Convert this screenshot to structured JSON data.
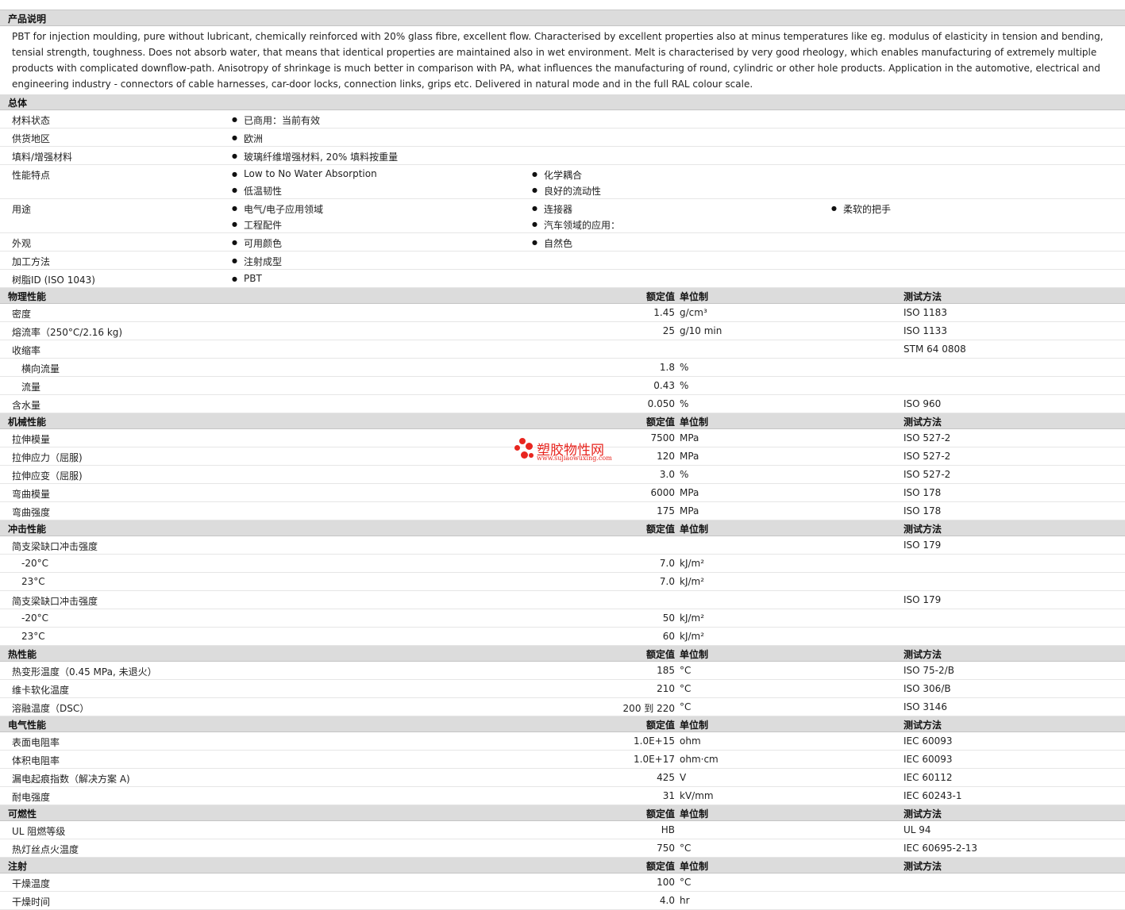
{
  "desc_header": "产品说明",
  "description": "PBT for injection moulding, pure without lubricant, chemically reinforced with 20% glass fibre, excellent flow. Characterised by excellent properties also at minus temperatures like eg. modulus of elasticity in tension and bending, tensial strength, toughness. Does not absorb water, that means that identical properties are maintained also in wet environment. Melt is characterised by very good rheology, which enables manufacturing of extremely multiple products with complicated downflow-path. Anisotropy of shrinkage is much better in comparison with PA, what influences the manufacturing of round, cylindric or other hole products. Application in the automotive, electrical and engineering industry - connectors of cable harnesses, car-door locks, connection links, grips etc. Delivered in natural mode and in the full RAL colour scale.",
  "general": {
    "title": "总体",
    "rows": [
      {
        "name": "材料状态",
        "height": 23,
        "items": [
          {
            "text": "已商用：当前有效",
            "col": 0,
            "line": 0
          }
        ]
      },
      {
        "name": "供货地区",
        "height": 23,
        "items": [
          {
            "text": "欧洲",
            "col": 0,
            "line": 0
          }
        ]
      },
      {
        "name": "填料/增强材料",
        "height": 23,
        "items": [
          {
            "text": "玻璃纤维增强材料, 20% 填料按重量",
            "col": 0,
            "line": 0
          }
        ]
      },
      {
        "name": "性能特点",
        "height": 43,
        "items": [
          {
            "text": "Low to No Water Absorption",
            "col": 0,
            "line": 0
          },
          {
            "text": "化学耦合",
            "col": 1,
            "line": 0
          },
          {
            "text": "低温韧性",
            "col": 0,
            "line": 1
          },
          {
            "text": "良好的流动性",
            "col": 1,
            "line": 1
          }
        ]
      },
      {
        "name": "用途",
        "height": 43,
        "items": [
          {
            "text": "电气/电子应用领域",
            "col": 0,
            "line": 0
          },
          {
            "text": "连接器",
            "col": 1,
            "line": 0
          },
          {
            "text": "柔软的把手",
            "col": 2,
            "line": 0
          },
          {
            "text": "工程配件",
            "col": 0,
            "line": 1
          },
          {
            "text": "汽车领域的应用：",
            "col": 1,
            "line": 1
          }
        ]
      },
      {
        "name": "外观",
        "height": 23,
        "items": [
          {
            "text": "可用颜色",
            "col": 0,
            "line": 0
          },
          {
            "text": "自然色",
            "col": 1,
            "line": 0
          }
        ]
      },
      {
        "name": "加工方法",
        "height": 23,
        "items": [
          {
            "text": "注射成型",
            "col": 0,
            "line": 0
          }
        ]
      },
      {
        "name": "树脂ID (ISO 1043)",
        "height": 23,
        "items": [
          {
            "text": "PBT",
            "col": 0,
            "line": 0
          }
        ]
      }
    ]
  },
  "col_labels": {
    "value": "额定值",
    "unit": "单位制",
    "test": "测试方法"
  },
  "sections": [
    {
      "title": "物理性能",
      "rows": [
        {
          "name": "密度",
          "value": "1.45",
          "unit": "g/cm³",
          "method": "ISO 1183"
        },
        {
          "name": "熔流率（250°C/2.16 kg)",
          "value": "25",
          "unit": "g/10 min",
          "method": "ISO 1133"
        },
        {
          "name": "收缩率",
          "value": "",
          "unit": "",
          "method": "STM 64 0808"
        },
        {
          "name": "横向流量",
          "value": "1.8",
          "unit": "%",
          "method": "",
          "sub": true
        },
        {
          "name": "流量",
          "value": "0.43",
          "unit": "%",
          "method": "",
          "sub": true
        },
        {
          "name": "含水量",
          "value": "0.050",
          "unit": "%",
          "method": "ISO 960"
        }
      ]
    },
    {
      "title": "机械性能",
      "rows": [
        {
          "name": "拉伸模量",
          "value": "7500",
          "unit": "MPa",
          "method": "ISO 527-2"
        },
        {
          "name": "拉伸应力（屈服)",
          "value": "120",
          "unit": "MPa",
          "method": "ISO 527-2"
        },
        {
          "name": "拉伸应变（屈服)",
          "value": "3.0",
          "unit": "%",
          "method": "ISO 527-2"
        },
        {
          "name": "弯曲模量",
          "value": "6000",
          "unit": "MPa",
          "method": "ISO 178"
        },
        {
          "name": "弯曲强度",
          "value": "175",
          "unit": "MPa",
          "method": "ISO 178"
        }
      ]
    },
    {
      "title": "冲击性能",
      "rows": [
        {
          "name": "简支梁缺口冲击强度",
          "value": "",
          "unit": "",
          "method": "ISO 179"
        },
        {
          "name": "-20°C",
          "value": "7.0",
          "unit": "kJ/m²",
          "method": "",
          "sub": true
        },
        {
          "name": "23°C",
          "value": "7.0",
          "unit": "kJ/m²",
          "method": "",
          "sub": true
        },
        {
          "name": "简支梁缺口冲击强度",
          "value": "",
          "unit": "",
          "method": "ISO 179"
        },
        {
          "name": "-20°C",
          "value": "50",
          "unit": "kJ/m²",
          "method": "",
          "sub": true
        },
        {
          "name": "23°C",
          "value": "60",
          "unit": "kJ/m²",
          "method": "",
          "sub": true
        }
      ]
    },
    {
      "title": "热性能",
      "rows": [
        {
          "name": "热变形温度（0.45 MPa, 未退火）",
          "value": "185",
          "unit": "°C",
          "method": "ISO 75-2/B"
        },
        {
          "name": "维卡软化温度",
          "value": "210",
          "unit": "°C",
          "method": "ISO 306/B"
        },
        {
          "name": "溶融温度（DSC）",
          "value": "200 到  220",
          "unit": "°C",
          "method": "ISO 3146"
        }
      ]
    },
    {
      "title": "电气性能",
      "rows": [
        {
          "name": "表面电阻率",
          "value": "1.0E+15",
          "unit": "ohm",
          "method": "IEC 60093"
        },
        {
          "name": "体积电阻率",
          "value": "1.0E+17",
          "unit": "ohm·cm",
          "method": "IEC 60093"
        },
        {
          "name": "漏电起痕指数（解决方案  A)",
          "value": "425",
          "unit": "V",
          "method": "IEC 60112"
        },
        {
          "name": "耐电强度",
          "value": "31",
          "unit": "kV/mm",
          "method": "IEC 60243-1"
        }
      ]
    },
    {
      "title": "可燃性",
      "rows": [
        {
          "name": "UL 阻燃等级",
          "value": "HB",
          "unit": "",
          "method": "UL 94"
        },
        {
          "name": "热灯丝点火温度",
          "value": "750",
          "unit": "°C",
          "method": "IEC 60695-2-13"
        }
      ]
    },
    {
      "title": "注射",
      "rows": [
        {
          "name": "干燥温度",
          "value": "100",
          "unit": "°C",
          "method": ""
        },
        {
          "name": "干燥时间",
          "value": "4.0",
          "unit": "hr",
          "method": ""
        }
      ]
    }
  ],
  "watermark": {
    "title": "塑胶物性网",
    "url": "www.sujiaowuxing.com",
    "color": "#e8251f"
  }
}
